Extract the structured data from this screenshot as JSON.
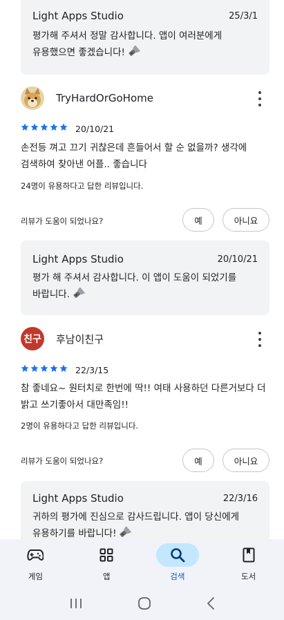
{
  "reply_top": {
    "name": "Light Apps Studio",
    "date": "25/3/1",
    "line1": "평가해 주셔서 정말 감사합니다. 앱이 여러분에게",
    "line2": "유용했으면 좋겠습니다!"
  },
  "review1": {
    "name": "TryHardOrGoHome",
    "rating": 5,
    "date": "20/10/21",
    "line1": "손전등 껴고 끄기 귀찮은데 흔들어서 할 순 없을까? 생각에",
    "line2": "검색하여 찾아낸 어플.. 좋습니다",
    "helpful_count": "24명이 유용하다고 답한 리뷰입니다.",
    "helpful_question": "리뷰가 도움이 되었나요?",
    "yes": "예",
    "no": "아니요"
  },
  "reply1": {
    "name": "Light Apps Studio",
    "date": "20/10/21",
    "line1": "평가 해 주셔서 감사합니다. 이 앱이 도움이 되었기를",
    "line2": "바랍니다."
  },
  "review2": {
    "avatar_text": "친구",
    "name": "후남이친구",
    "rating": 5,
    "date": "22/3/15",
    "line1": "참 좋네요~ 원터치로 한번에 딱!! 여태 사용하던 다른거보다 더",
    "line2": "밝고 쓰기좋아서 대만족임!!",
    "helpful_count": "2명이 유용하다고 답한 리뷰입니다.",
    "helpful_question": "리뷰가 도움이 되었나요?",
    "yes": "예",
    "no": "아니요"
  },
  "reply2": {
    "name": "Light Apps Studio",
    "date": "22/3/16",
    "line1": "귀하의 평가에 진심으로 감사드립니다. 앱이 당신에게",
    "line2": "유용하기를 바랍니다!"
  },
  "bottom_nav": {
    "items": [
      {
        "label": "게임",
        "icon": "gamepad-icon"
      },
      {
        "label": "앱",
        "icon": "apps-grid-icon"
      },
      {
        "label": "검색",
        "icon": "search-icon",
        "active": true
      },
      {
        "label": "도서",
        "icon": "book-icon"
      }
    ]
  },
  "colors": {
    "star": "#1a73e8",
    "active_nav_bg": "#c2e7ff",
    "active_nav_text": "#0b57d0",
    "reply_bg": "#f1f3f4"
  }
}
